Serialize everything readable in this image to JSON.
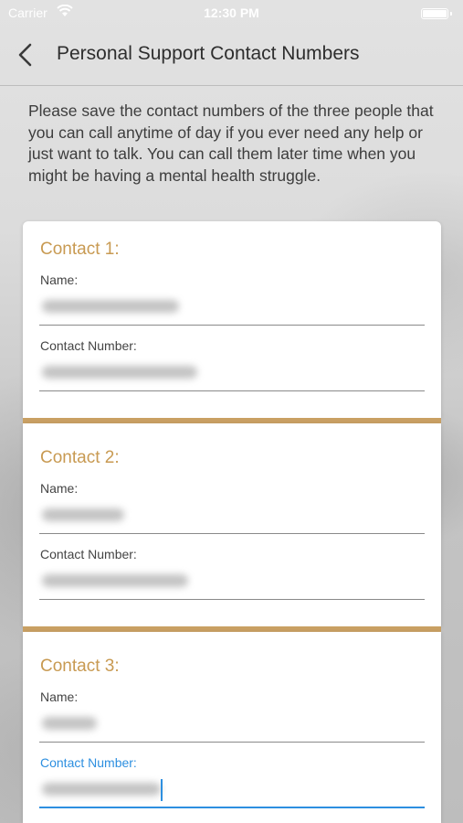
{
  "status_bar": {
    "carrier": "Carrier",
    "time": "12:30 PM",
    "wifi_icon": "wifi-icon",
    "battery_icon": "battery-icon"
  },
  "nav": {
    "back_icon": "chevron-left-icon",
    "title": "Personal Support Contact Numbers"
  },
  "intro": "Please save the contact numbers of the three people that you can call anytime of day if you ever need any help or just want to talk. You can call them later time when you might be having a mental health struggle.",
  "accent_color": "#c89a52",
  "active_color": "#2d8fe0",
  "contacts": [
    {
      "heading": "Contact 1:",
      "name_label": "Name:",
      "name_value": "",
      "number_label": "Contact Number:",
      "number_value": ""
    },
    {
      "heading": "Contact 2:",
      "name_label": "Name:",
      "name_value": "",
      "number_label": "Contact Number:",
      "number_value": ""
    },
    {
      "heading": "Contact 3:",
      "name_label": "Name:",
      "name_value": "",
      "number_label": "Contact Number:",
      "number_value": ""
    }
  ]
}
